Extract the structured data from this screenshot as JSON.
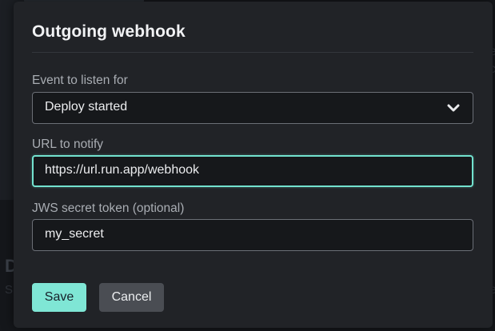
{
  "dialog": {
    "title": "Outgoing webhook"
  },
  "fields": {
    "event": {
      "label": "Event to listen for",
      "value": "Deploy started",
      "icon": "chevron-down-icon"
    },
    "url": {
      "label": "URL to notify",
      "value": "https://url.run.app/webhook"
    },
    "secret": {
      "label": "JWS secret token (optional)",
      "value": "my_secret"
    }
  },
  "buttons": {
    "save_label": "Save",
    "cancel_label": "Cancel"
  },
  "colors": {
    "accent": "#7fe6d5",
    "focus_border": "#73e2cf",
    "modal_bg": "#212327",
    "input_bg": "#16181b"
  }
}
